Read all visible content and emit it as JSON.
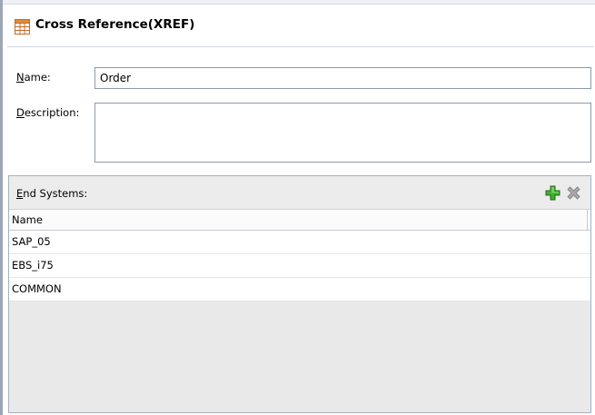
{
  "header": {
    "title": "Cross Reference(XREF)"
  },
  "form": {
    "name_label": "Name:",
    "name_value": "Order",
    "description_label": "Description:",
    "description_value": ""
  },
  "end_systems": {
    "label": "End Systems:",
    "column_header": "Name",
    "rows": [
      "SAP_05",
      "EBS_i75",
      "COMMON"
    ],
    "add_icon": "add-plus-icon",
    "delete_icon": "delete-x-icon"
  },
  "colors": {
    "add_green": "#2e9a25",
    "delete_grey": "#9a9a9a",
    "border": "#8e9aa8"
  }
}
